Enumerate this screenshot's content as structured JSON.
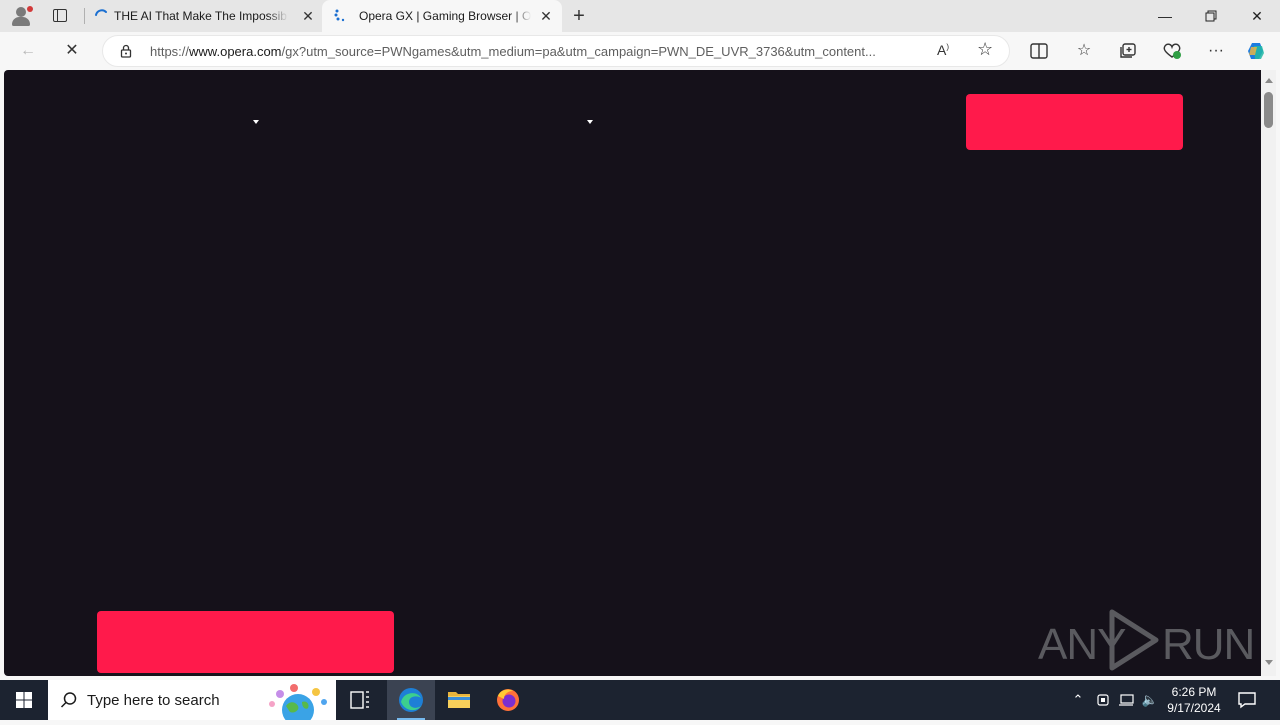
{
  "browser": {
    "tabs": [
      {
        "title": "THE AI That Make The Impossible",
        "active": false
      },
      {
        "title": "Opera GX | Gaming Browser | Opera",
        "active": true
      }
    ],
    "new_tab_label": "+",
    "address_bar": {
      "url_prefix": "https://",
      "url_host": "www.opera.com",
      "url_rest": "/gx?utm_source=PWNgames&utm_medium=pa&utm_campaign=PWN_DE_UVR_3736&utm_content..."
    }
  },
  "page": {
    "background_color": "#15111a",
    "accent_color": "#ff1a4b",
    "watermark": "ANY RUN"
  },
  "taskbar": {
    "search_placeholder": "Type here to search",
    "time": "6:26 PM",
    "date": "9/17/2024"
  }
}
